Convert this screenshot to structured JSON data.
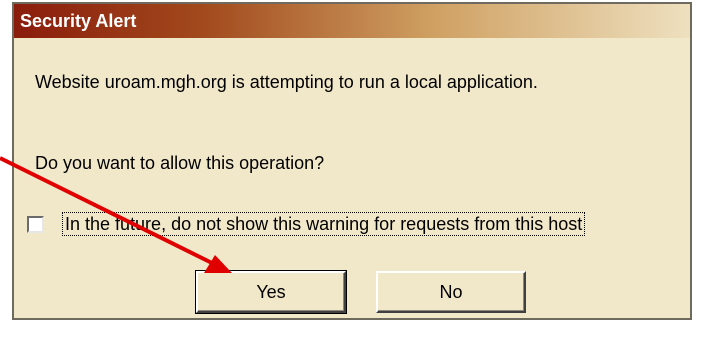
{
  "dialog": {
    "title": "Security Alert",
    "message": "Website uroam.mgh.org is attempting to run a local application.",
    "question": "Do you want to allow this operation?",
    "checkbox_label": "In the future, do not show this warning for requests from this host",
    "checkbox_checked": false,
    "yes_button": "Yes",
    "no_button": "No",
    "titlebar_color": "#8a1c0c",
    "background_color": "#f1e7c9"
  },
  "annotation": {
    "arrow_color": "#e00000",
    "arrow_target": "yes_button"
  }
}
